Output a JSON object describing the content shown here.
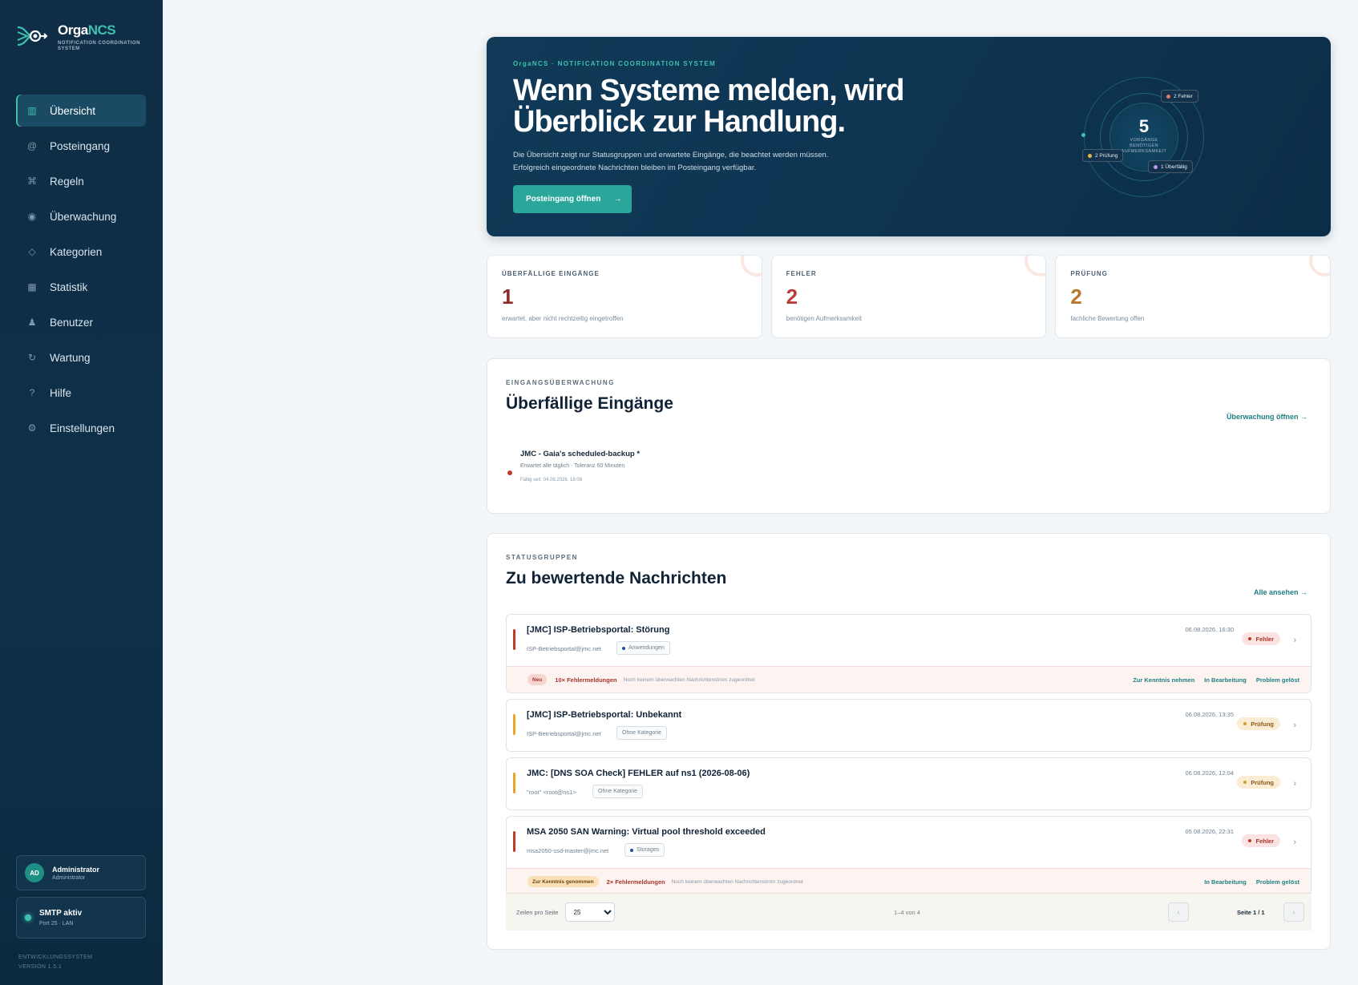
{
  "brand": {
    "name_main": "Orga",
    "name_accent": "NCS",
    "subtitle": "NOTIFICATION COORDINATION SYSTEM"
  },
  "nav": [
    {
      "label": "Übersicht",
      "icon": "▥",
      "active": true
    },
    {
      "label": "Posteingang",
      "icon": "@"
    },
    {
      "label": "Regeln",
      "icon": "⌘"
    },
    {
      "label": "Überwachung",
      "icon": "◉"
    },
    {
      "label": "Kategorien",
      "icon": "◇"
    },
    {
      "label": "Statistik",
      "icon": "▦"
    },
    {
      "label": "Benutzer",
      "icon": "♟"
    },
    {
      "label": "Wartung",
      "icon": "↻"
    },
    {
      "label": "Hilfe",
      "icon": "?"
    },
    {
      "label": "Einstellungen",
      "icon": "⚙"
    }
  ],
  "user": {
    "initials": "AD",
    "name": "Administrator",
    "role": "Administrator"
  },
  "smtp": {
    "title": "SMTP aktiv",
    "sub": "Port 25 · LAN"
  },
  "version": {
    "line1": "ENTWICKLUNGSSYSTEM",
    "line2": "VERSION 1.5.1"
  },
  "hero": {
    "eyebrow": "OrgaNCS · NOTIFICATION COORDINATION SYSTEM",
    "title_line1": "Wenn Systeme melden, wird",
    "title_line2": "Überblick zur Handlung.",
    "desc_line1": "Die Übersicht zeigt nur Statusgruppen und erwartete Eingänge, die beachtet werden müssen.",
    "desc_line2": "Erfolgreich eingeordnete Nachrichten bleiben im Posteingang verfügbar.",
    "button": "Posteingang öffnen",
    "button_arrow": "→",
    "orbit": {
      "count": "5",
      "label_line1": "VORGÄNGE",
      "label_line2": "BENÖTIGEN",
      "label_line3": "AUFMERKSAMKEIT",
      "chip_errors": "2 Fehler",
      "chip_review": "2 Prüfung",
      "chip_overdue": "1 Überfällig"
    }
  },
  "stats": [
    {
      "label": "ÜBERFÄLLIGE EINGÄNGE",
      "value": "1",
      "sub": "erwartet, aber nicht rechtzeitig eingetroffen",
      "color": "#8e2a2a"
    },
    {
      "label": "FEHLER",
      "value": "2",
      "sub": "benötigen Aufmerksamkeit",
      "color": "#b9403a"
    },
    {
      "label": "PRÜFUNG",
      "value": "2",
      "sub": "fachliche Bewertung offen",
      "color": "#b9782a"
    }
  ],
  "monitor": {
    "eyebrow": "EINGANGSÜBERWACHUNG",
    "title": "Überfällige Eingänge",
    "link": "Überwachung öffnen →",
    "item": {
      "title": "JMC - Gaia's scheduled-backup *",
      "meta": "Erwartet alle täglich · Toleranz 60 Minuten",
      "since": "Fällig seit: 04.08.2026, 18:08"
    }
  },
  "groups": {
    "eyebrow": "STATUSGRUPPEN",
    "title": "Zu bewertende Nachrichten",
    "link": "Alle ansehen →",
    "messages": [
      {
        "title": "[JMC] ISP-Betriebsportal: Störung",
        "sender": "ISP-Betriebsportal@jmc.net",
        "tag": "Anwendungen",
        "date": "06.08.2026, 16:30",
        "status": "Fehler",
        "foot": {
          "pill": "Neu",
          "count": "10× Fehlermeldungen",
          "note": "Noch keinem überwachten Nachrichtenstrom zugeordnet",
          "actions": [
            "Zur Kenntnis nehmen",
            "In Bearbeitung",
            "Problem gelöst"
          ]
        }
      },
      {
        "title": "[JMC] ISP-Betriebsportal: Unbekannt",
        "sender": "ISP-Betriebsportal@jmc.net",
        "tag": "Ohne Kategorie",
        "date": "06.08.2026, 13:35",
        "status": "Prüfung"
      },
      {
        "title": "JMC: [DNS SOA Check] FEHLER auf ns1 (2026-08-06)",
        "sender": "\"root\" <root@ns1>",
        "tag": "Ohne Kategorie",
        "date": "06.08.2026, 12:04",
        "status": "Prüfung"
      },
      {
        "title": "MSA 2050 SAN Warning: Virtual pool threshold exceeded",
        "sender": "msa2050-ssd-master@jmc.net",
        "tag": "Storages",
        "date": "05.08.2026, 22:31",
        "status": "Fehler",
        "foot": {
          "pill": "Zur Kenntnis genommen",
          "count": "2× Fehlermeldungen",
          "note": "Noch keinem überwachten Nachrichtenstrom zugeordnet",
          "actions": [
            "In Bearbeitung",
            "Problem gelöst"
          ]
        }
      }
    ],
    "pager": {
      "rows_label": "Zeilen pro Seite",
      "rows_value": "25",
      "range": "1–4 von 4",
      "page": "Seite 1 / 1",
      "prev": "‹",
      "next": "›"
    }
  },
  "colors": {
    "accent": "#3fc1b0",
    "sidebar": "#0f2d46",
    "error": "#c0392b",
    "review": "#d99a2b"
  }
}
